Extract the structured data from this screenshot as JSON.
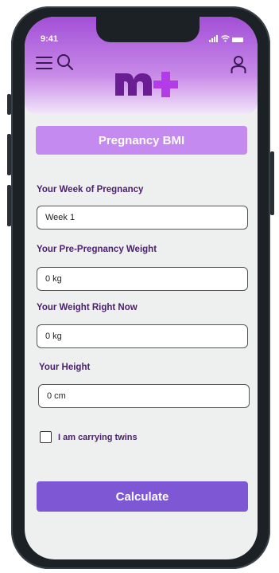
{
  "status": {
    "time": "9:41"
  },
  "header": {
    "logo_text": "m+",
    "icons": [
      "menu-icon",
      "search-icon",
      "user-icon"
    ],
    "brand_color": "#6b1d93",
    "accent_color": "#c58af0"
  },
  "main": {
    "title": "Pregnancy BMI",
    "fields": [
      {
        "label": "Your Week of Pregnancy",
        "value": "Week 1"
      },
      {
        "label": "Your Pre-Pregnancy Weight",
        "value": "0 kg"
      },
      {
        "label": "Your Weight Right Now",
        "value": "0 kg"
      },
      {
        "label": "Your Height",
        "value": "0 cm"
      }
    ],
    "twins_label": "I am carrying twins",
    "twins_checked": false,
    "calculate_label": "Calculate",
    "button_color": "#7e57d4"
  }
}
